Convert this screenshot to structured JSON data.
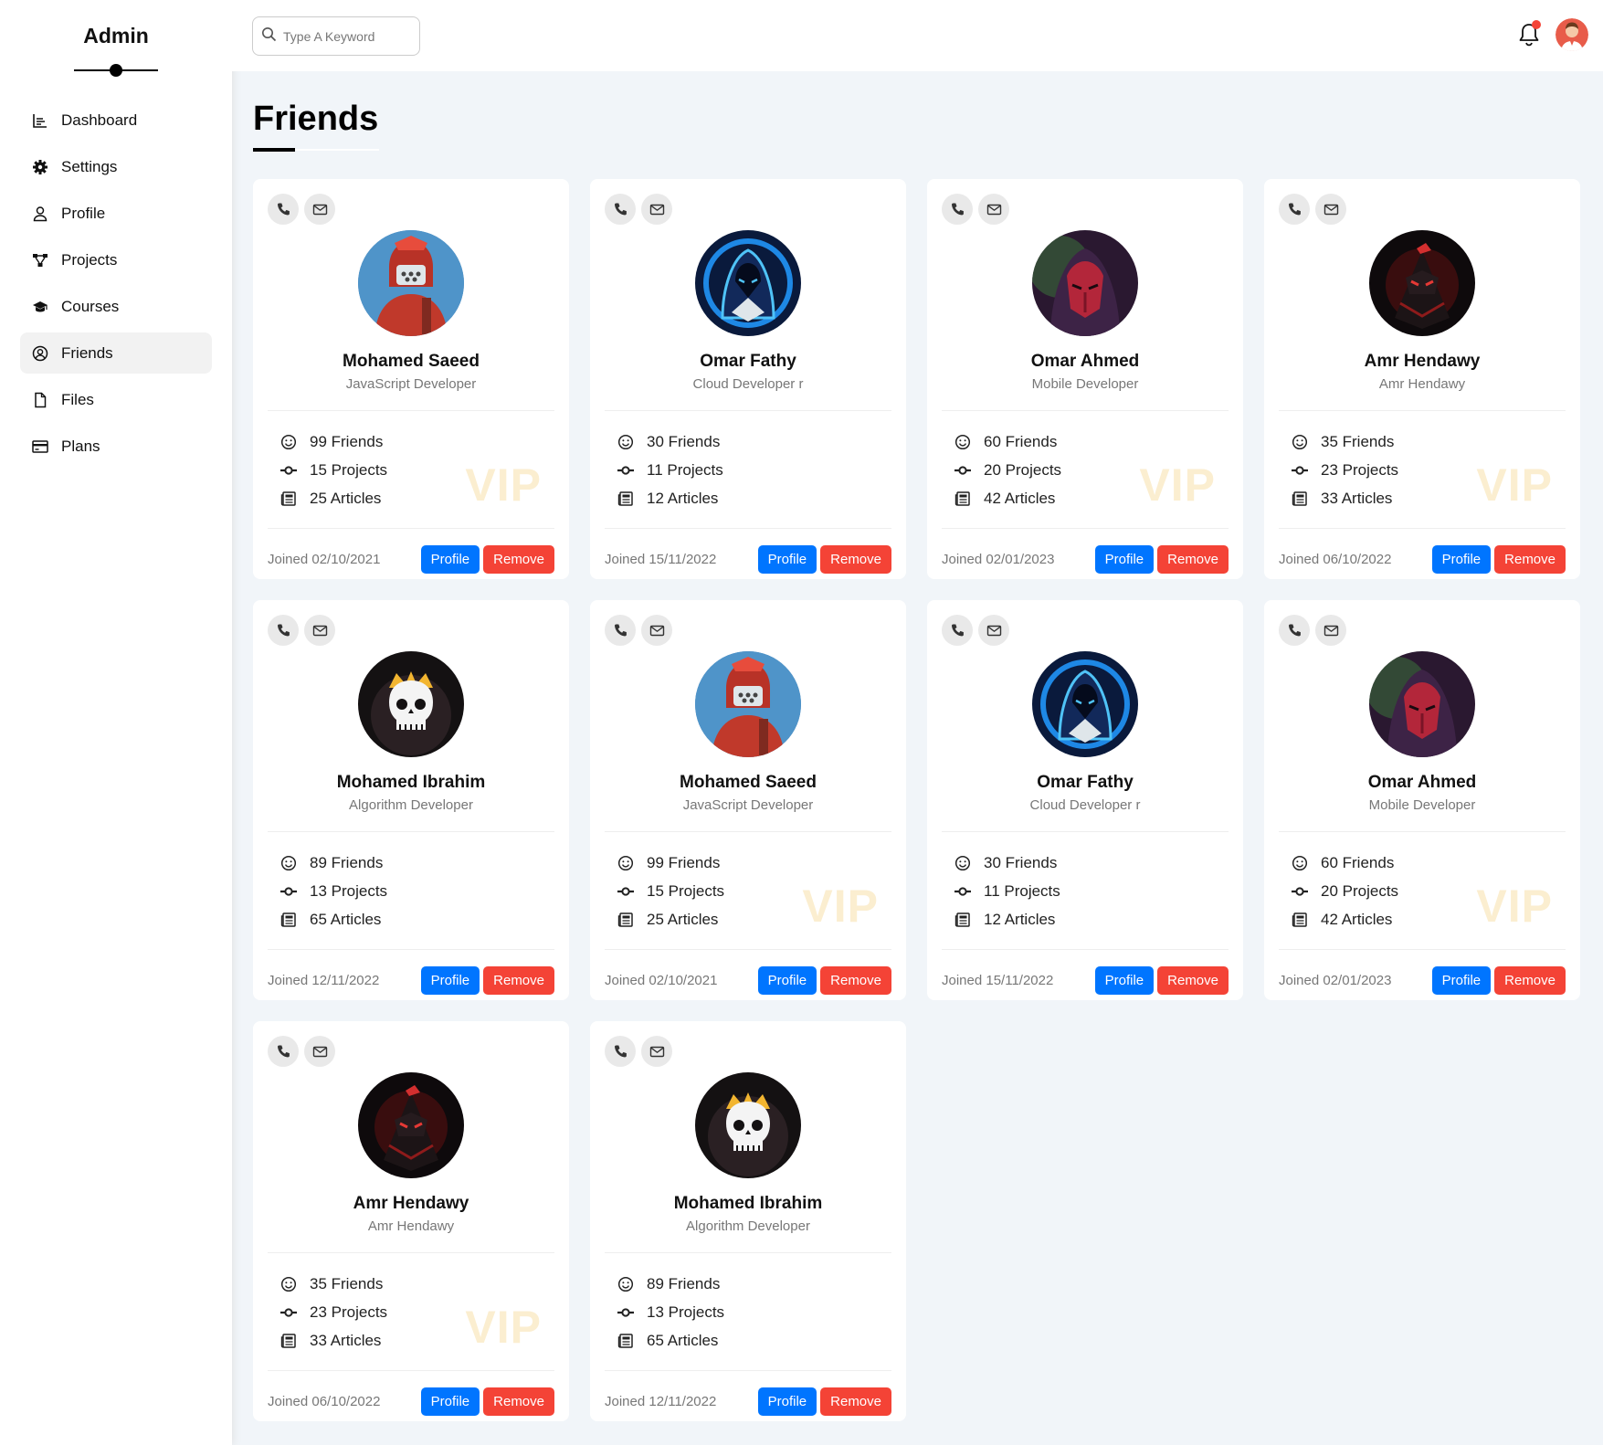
{
  "sidebar": {
    "brand": "Admin",
    "items": [
      {
        "label": "Dashboard",
        "icon": "chart-icon",
        "active": false
      },
      {
        "label": "Settings",
        "icon": "gear-icon",
        "active": false
      },
      {
        "label": "Profile",
        "icon": "user-icon",
        "active": false
      },
      {
        "label": "Projects",
        "icon": "diagram-icon",
        "active": false
      },
      {
        "label": "Courses",
        "icon": "graduation-cap-icon",
        "active": false
      },
      {
        "label": "Friends",
        "icon": "user-circle-icon",
        "active": true
      },
      {
        "label": "Files",
        "icon": "file-icon",
        "active": false
      },
      {
        "label": "Plans",
        "icon": "credit-card-icon",
        "active": false
      }
    ]
  },
  "header": {
    "search_placeholder": "Type A Keyword",
    "notification_icon": "bell-icon",
    "notification_dot_color": "#f44336"
  },
  "main": {
    "title": "Friends"
  },
  "colors": {
    "primary": "#0075ff",
    "danger": "#f44336",
    "vip": "#fbeed0",
    "background": "#f1f5f9"
  },
  "cards": [
    {
      "name": "Mohamed Saeed",
      "role": "JavaScript Developer",
      "friends": "99 Friends",
      "projects": "15 Projects",
      "articles": "25 Articles",
      "joined": "Joined 02/10/2021",
      "vip": "VIP",
      "avatar": "red-warrior"
    },
    {
      "name": "Omar Fathy",
      "role": "Cloud Developer r",
      "friends": "30 Friends",
      "projects": "11 Projects",
      "articles": "12 Articles",
      "joined": "Joined 15/11/2022",
      "vip": "",
      "avatar": "blue-hood"
    },
    {
      "name": "Omar Ahmed",
      "role": "Mobile Developer",
      "friends": "60 Friends",
      "projects": "20 Projects",
      "articles": "42 Articles",
      "joined": "Joined 02/01/2023",
      "vip": "VIP",
      "avatar": "red-mask"
    },
    {
      "name": "Amr Hendawy",
      "role": "Amr Hendawy",
      "friends": "35 Friends",
      "projects": "23 Projects",
      "articles": "33 Articles",
      "joined": "Joined 06/10/2022",
      "vip": "VIP",
      "avatar": "dark-ninja"
    },
    {
      "name": "Mohamed Ibrahim",
      "role": "Algorithm Developer",
      "friends": "89 Friends",
      "projects": "13 Projects",
      "articles": "65 Articles",
      "joined": "Joined 12/11/2022",
      "vip": "",
      "avatar": "skull-king"
    },
    {
      "name": "Mohamed Saeed",
      "role": "JavaScript Developer",
      "friends": "99 Friends",
      "projects": "15 Projects",
      "articles": "25 Articles",
      "joined": "Joined 02/10/2021",
      "vip": "VIP",
      "avatar": "red-warrior"
    },
    {
      "name": "Omar Fathy",
      "role": "Cloud Developer r",
      "friends": "30 Friends",
      "projects": "11 Projects",
      "articles": "12 Articles",
      "joined": "Joined 15/11/2022",
      "vip": "",
      "avatar": "blue-hood"
    },
    {
      "name": "Omar Ahmed",
      "role": "Mobile Developer",
      "friends": "60 Friends",
      "projects": "20 Projects",
      "articles": "42 Articles",
      "joined": "Joined 02/01/2023",
      "vip": "VIP",
      "avatar": "red-mask"
    },
    {
      "name": "Amr Hendawy",
      "role": "Amr Hendawy",
      "friends": "35 Friends",
      "projects": "23 Projects",
      "articles": "33 Articles",
      "joined": "Joined 06/10/2022",
      "vip": "VIP",
      "avatar": "dark-ninja"
    },
    {
      "name": "Mohamed Ibrahim",
      "role": "Algorithm Developer",
      "friends": "89 Friends",
      "projects": "13 Projects",
      "articles": "65 Articles",
      "joined": "Joined 12/11/2022",
      "vip": "",
      "avatar": "skull-king"
    }
  ],
  "card_labels": {
    "profile_button": "Profile",
    "remove_button": "Remove"
  }
}
